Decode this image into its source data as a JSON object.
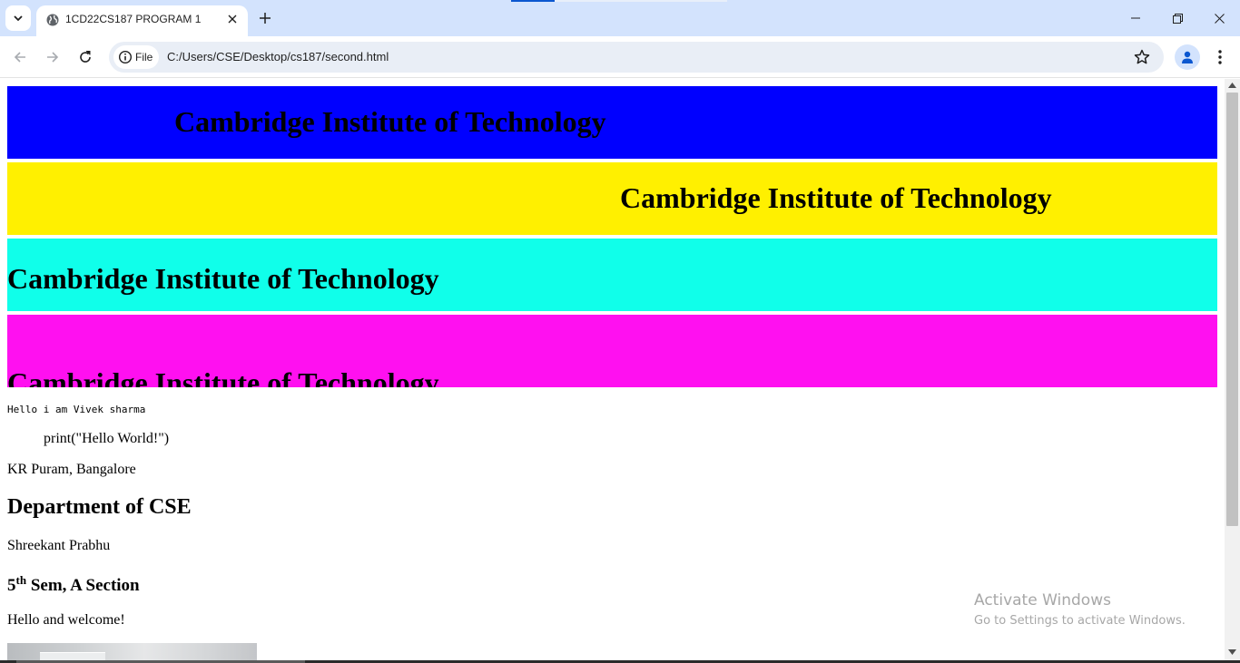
{
  "browser": {
    "tab_title": "1CD22CS187 PROGRAM 1",
    "security_chip": "File",
    "url": "C:/Users/CSE/Desktop/cs187/second.html",
    "icons": [
      "tab-search-icon",
      "globe-icon",
      "close-icon",
      "plus-icon",
      "minimize-icon",
      "restore-icon",
      "window-close-icon",
      "back-arrow-icon",
      "forward-arrow-icon",
      "reload-icon",
      "info-icon",
      "star-icon",
      "profile-icon",
      "kebab-menu-icon"
    ]
  },
  "page": {
    "banners": [
      {
        "text": "Cambridge Institute of Technology",
        "color": "#0000ff"
      },
      {
        "text": "Cambridge Institute of Technology",
        "color": "#fff000"
      },
      {
        "text": "Cambridge Institute of Technology",
        "color": "#10ffea"
      },
      {
        "text": "Cambridge Institute of Technology",
        "color": "#ff10f0"
      }
    ],
    "mono_text": "Hello i am Vivek sharma",
    "pre_text": "print(\"Hello World!\")",
    "address": "KR Puram, Bangalore",
    "department": "Department of CSE",
    "name": "Shreekant Prabhu",
    "sem_number": "5",
    "sem_sup": "th",
    "sem_rest": " Sem, A Section",
    "welcome": "Hello and welcome!"
  },
  "watermark": {
    "title": "Activate Windows",
    "subtitle": "Go to Settings to activate Windows."
  }
}
